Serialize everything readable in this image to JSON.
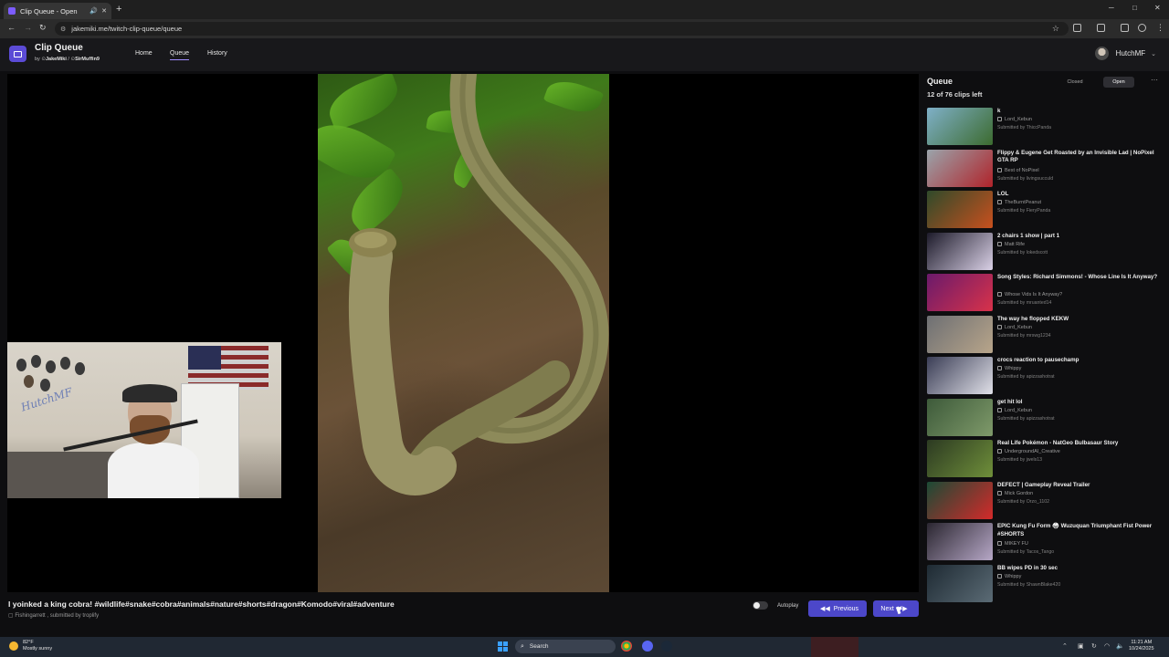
{
  "browser": {
    "tab_title": "Clip Queue - Open",
    "new_tab": "+",
    "url": "jakemiki.me/twitch-clip-queue/queue",
    "controls": {
      "minimize": "─",
      "maximize": "□",
      "close": "✕"
    }
  },
  "app": {
    "title": "Clip Queue",
    "by_prefix": "by",
    "author1": "JakeMiki",
    "separator": "/",
    "author2": "SirMuffin9",
    "nav": [
      {
        "label": "Home"
      },
      {
        "label": "Queue"
      },
      {
        "label": "History"
      }
    ],
    "user_name": "HutchMF"
  },
  "webcam": {
    "sign_text": "HutchMF"
  },
  "current_clip": {
    "title": "I yoinked a king cobra! #wildlife#snake#cobra#animals#nature#shorts#dragon#Komodo#viral#adventure",
    "channel": "Fishingarrett",
    "submitted_prefix": ", submitted by",
    "submitted_by": "troplify"
  },
  "controls": {
    "autoplay_label": "Autoplay",
    "previous_label": "Previous",
    "next_label": "Next"
  },
  "queue": {
    "title": "Queue",
    "count": "12 of 76 clips left",
    "closed_label": "Closed",
    "open_label": "Open",
    "more": "···",
    "items": [
      {
        "title": "k",
        "channel": "Lord_Kebun",
        "submitted": "Submitted by ThiccPanda",
        "thumb": [
          "#7fb0c8",
          "#3c6b2f"
        ]
      },
      {
        "title": "Flippy & Eugene Get Roasted by an Invisible Lad | NoPixel GTA RP",
        "channel": "Best of NoPixel",
        "submitted": "Submitted by livingsucculd",
        "thumb": [
          "#9aa4ab",
          "#b0232a"
        ]
      },
      {
        "title": "LOL",
        "channel": "TheBurntPeanut",
        "submitted": "Submitted by FieryPanda",
        "thumb": [
          "#2f4a2a",
          "#c8501e"
        ]
      },
      {
        "title": "2 chairs 1 show | part 1",
        "channel": "Matt Rife",
        "submitted": "Submitted by lokedscott",
        "thumb": [
          "#1d1b2a",
          "#d9d0e6"
        ]
      },
      {
        "title": "Song Styles: Richard Simmons! - Whose Line Is It Anyway?",
        "channel": "Whose Vids Is It Anyway?",
        "submitted": "Submitted by mruanted14",
        "thumb": [
          "#6a1a6b",
          "#d8324a"
        ]
      },
      {
        "title": "The way he flopped KEKW",
        "channel": "Lord_Kebun",
        "submitted": "Submitted by mrswg1234",
        "thumb": [
          "#6d6f73",
          "#b8a58a"
        ]
      },
      {
        "title": "crocs reaction to pausechamp",
        "channel": "Whippy",
        "submitted": "Submitted by apizzashotrat",
        "thumb": [
          "#3a3d55",
          "#e0e0e8"
        ]
      },
      {
        "title": "get hit lol",
        "channel": "Lord_Kebun",
        "submitted": "Submitted by apizzashotrat",
        "thumb": [
          "#3d5a3a",
          "#7f9a6a"
        ]
      },
      {
        "title": "Real Life Pokémon - NatGeo Bulbasaur Story",
        "channel": "UndergroundAI_Creative",
        "submitted": "Submitted by jwels13",
        "thumb": [
          "#2c3a22",
          "#6f8f3a"
        ]
      },
      {
        "title": "DEFECT | Gameplay Reveal Trailer",
        "channel": "Mick Gordon",
        "submitted": "Submitted by Orzo_1102",
        "thumb": [
          "#1b4a35",
          "#d42a2a"
        ]
      },
      {
        "title": "EPIC Kung Fu Form 🥋 Wuzuquan Triumphant Fist Power #SHORTS",
        "channel": "MIKEY FU",
        "submitted": "Submitted by Tacos_Tango",
        "thumb": [
          "#2a2630",
          "#b6a7c6"
        ]
      },
      {
        "title": "BB wipes PD in 30 sec",
        "channel": "Whippy",
        "submitted": "Submitted by ShawnBlake420",
        "thumb": [
          "#1e2a33",
          "#5b6b75"
        ]
      }
    ]
  },
  "taskbar": {
    "temp": "82°F",
    "weather": "Mostly sunny",
    "search_placeholder": "Search",
    "time": "11:21 AM",
    "date": "10/24/2025"
  },
  "colors": {
    "accent": "#4c47c9",
    "app_bg": "#0e0e10",
    "header_bg": "#18181b"
  },
  "icons": [
    "search-icon",
    "star-icon",
    "play-icon",
    "previous-icon",
    "next-icon",
    "windows-icon"
  ]
}
